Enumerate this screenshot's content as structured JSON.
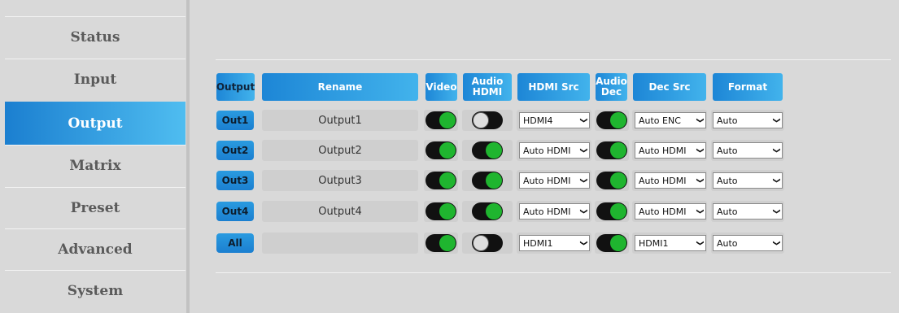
{
  "sidebar": {
    "items": [
      {
        "label": "Status"
      },
      {
        "label": "Input"
      },
      {
        "label": "Output"
      },
      {
        "label": "Matrix"
      },
      {
        "label": "Preset"
      },
      {
        "label": "Advanced"
      },
      {
        "label": "System"
      }
    ],
    "active": "Output"
  },
  "table": {
    "headers": {
      "output": "Output",
      "rename": "Rename",
      "video": "Video",
      "audio_hdmi_1": "Audio",
      "audio_hdmi_2": "HDMI",
      "hdmi_src": "HDMI Src",
      "audio_dec_1": "Audio",
      "audio_dec_2": "Dec",
      "dec_src": "Dec Src",
      "format": "Format"
    },
    "rows": [
      {
        "button": "Out1",
        "name": "Output1",
        "video": true,
        "audio_hdmi": false,
        "hdmi_src": "HDMI4",
        "audio_dec": true,
        "dec_src": "Auto ENC",
        "format": "Auto"
      },
      {
        "button": "Out2",
        "name": "Output2",
        "video": true,
        "audio_hdmi": true,
        "hdmi_src": "Auto HDMI",
        "audio_dec": true,
        "dec_src": "Auto HDMI",
        "format": "Auto"
      },
      {
        "button": "Out3",
        "name": "Output3",
        "video": true,
        "audio_hdmi": true,
        "hdmi_src": "Auto HDMI",
        "audio_dec": true,
        "dec_src": "Auto HDMI",
        "format": "Auto"
      },
      {
        "button": "Out4",
        "name": "Output4",
        "video": true,
        "audio_hdmi": true,
        "hdmi_src": "Auto HDMI",
        "audio_dec": true,
        "dec_src": "Auto HDMI",
        "format": "Auto"
      },
      {
        "button": "All",
        "name": "",
        "video": true,
        "audio_hdmi": false,
        "hdmi_src": "HDMI1",
        "audio_dec": true,
        "dec_src": "HDMI1",
        "format": "Auto"
      }
    ]
  },
  "colors": {
    "accent": "#1b7fd0",
    "accent_light": "#4fbdf0",
    "toggle_on": "#1fb52f",
    "background": "#d9d9d9"
  }
}
